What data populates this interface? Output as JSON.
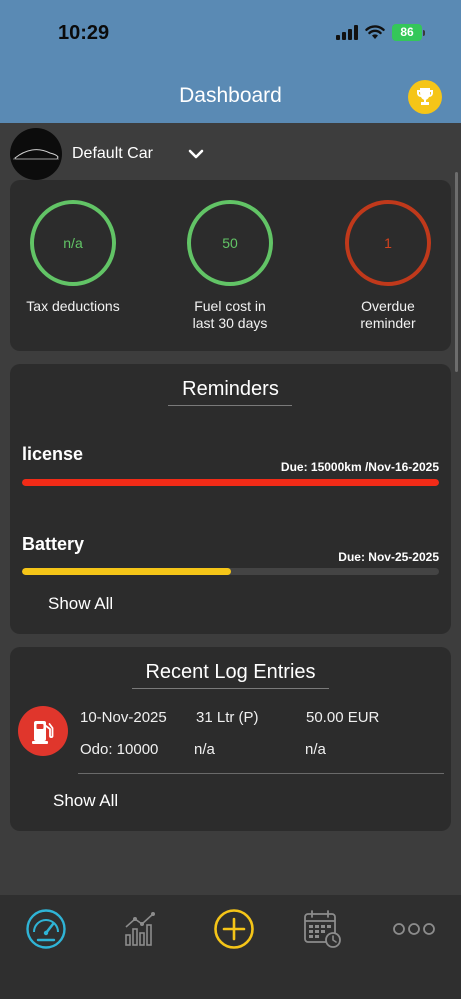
{
  "status_bar": {
    "time": "10:29",
    "battery": "86"
  },
  "header": {
    "title": "Dashboard",
    "action_icon": "trophy-icon",
    "accent": "#f5c518"
  },
  "car_selector": {
    "name": "Default Car"
  },
  "stats": [
    {
      "value": "n/a",
      "label": "Tax deductions",
      "color": "#62c466"
    },
    {
      "value": "50",
      "label": "Fuel cost in last 30 days",
      "color": "#62c466"
    },
    {
      "value": "1",
      "label": "Overdue reminder",
      "color": "#c0391b"
    }
  ],
  "reminders": {
    "title": "Reminders",
    "items": [
      {
        "name": "license",
        "due": "Due: 15000km /Nov-16-2025",
        "progress": 1.0,
        "color": "#f22b17"
      },
      {
        "name": "Battery",
        "due": "Due: Nov-25-2025",
        "progress": 0.5,
        "color": "#f5c518"
      }
    ],
    "show_all_label": "Show All"
  },
  "logs": {
    "title": "Recent Log Entries",
    "entries": [
      {
        "date": "10-Nov-2025",
        "volume": "31 Ltr (P)",
        "cost": "50.00 EUR",
        "odo": "Odo: 10000",
        "extra1": "n/a",
        "extra2": "n/a"
      }
    ],
    "show_all_label": "Show All"
  },
  "tabbar": {
    "items": [
      {
        "icon": "speedometer-icon",
        "active": true
      },
      {
        "icon": "statistics-icon",
        "active": false
      },
      {
        "icon": "add-icon",
        "active": false
      },
      {
        "icon": "calendar-icon",
        "active": false
      },
      {
        "icon": "more-icon",
        "active": false
      }
    ],
    "active_color": "#2fb4d6",
    "add_color": "#f5c518"
  }
}
